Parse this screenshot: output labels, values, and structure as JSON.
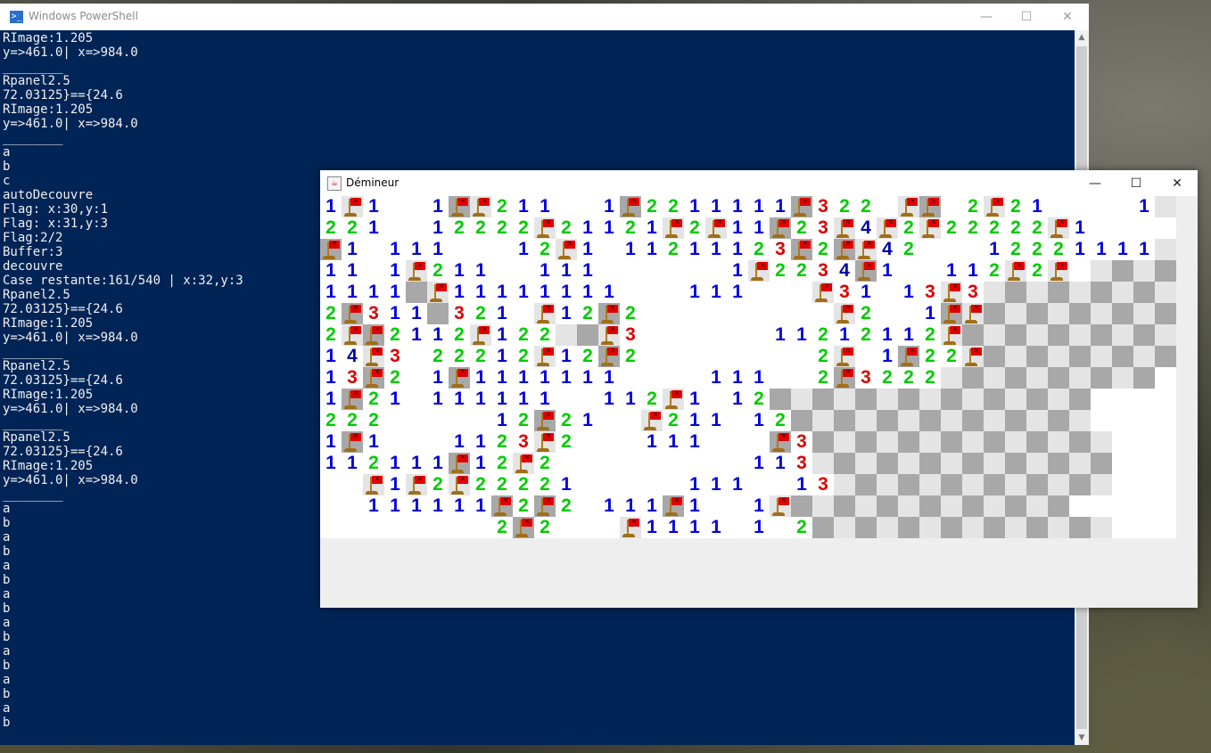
{
  "powershell": {
    "title": "Windows PowerShell",
    "lines": [
      "RImage:1.205",
      "y=>461.0| x=>984.0",
      "________",
      "Rpanel2.5",
      "72.03125}=={24.6",
      "RImage:1.205",
      "y=>461.0| x=>984.0",
      "________",
      "a",
      "b",
      "c",
      "autoDecouvre",
      "Flag: x:30,y:1",
      "Flag: x:31,y:3",
      "Flag:2/2",
      "Buffer:3",
      "decouvre",
      "Case restante:161/540 | x:32,y:3",
      "Rpanel2.5",
      "72.03125}=={24.6",
      "RImage:1.205",
      "y=>461.0| x=>984.0",
      "________",
      "Rpanel2.5",
      "72.03125}=={24.6",
      "RImage:1.205",
      "y=>461.0| x=>984.0",
      "________",
      "Rpanel2.5",
      "72.03125}=={24.6",
      "RImage:1.205",
      "y=>461.0| x=>984.0",
      "________",
      "a",
      "b",
      "a",
      "b",
      "a",
      "b",
      "a",
      "b",
      "a",
      "b",
      "a",
      "b",
      "a",
      "b",
      "a",
      "b"
    ],
    "buttons": {
      "minimize": "—",
      "maximize": "☐",
      "close": "✕"
    },
    "scroll_up": "▲",
    "scroll_down": "▼"
  },
  "minesweeper": {
    "title": "Démineur",
    "icon_glyph": "☕",
    "buttons": {
      "minimize": "—",
      "maximize": "☐",
      "close": "✕"
    },
    "columns": 40,
    "rows": 16,
    "cell_legend": {
      "0": "revealed-empty",
      "1-8": "revealed number",
      "F": "flagged cell",
      "u": "unrevealed cell (checkered)",
      "d": "unrevealed dark cell"
    },
    "colors": {
      "1": "#0000dd",
      "2": "#00cc00",
      "3": "#dd0000",
      "4": "#0000aa",
      "5": "#dd0000",
      "unrevealed_light": "#e4e4e4",
      "unrevealed_dark": "#a8a8a8",
      "revealed": "#ffffff",
      "flag": "#e00000"
    },
    "grid": [
      "1F1001FF211001F2211111F3220FF02F2100001duuu",
      "2210012222F21121F2F11F23F4F2F22222F1000001udud",
      "F1011100012F1011211123F2FF4200012221111dudu",
      "1101F211001110000001F2234F100112F2F0duduud",
      "1111uF11111111000111000F31013F3uduuududud",
      "2F311u3210F12F2000000000F2001FFuuduududud",
      "2FF2112F122ddF300000011212112Fududuududud",
      "14F3022212F12F2000000002F01F22Fduduuududud",
      "13F201F11111110000111002F3222ududuuudud",
      "1F21011111100112F1012dudududuuduudud",
      "2220000012F2100F211012ududuudududuud",
      "1F10001123F2000111000F3duduududududud",
      "112111F12F2000000000113ududuuudududud",
      "00F1F2F22221000001110013dudududuuduud",
      "00111111F2F20111F1001Fduduuudududud",
      "000000002F2000F111101 2ududduudududud"
    ]
  }
}
